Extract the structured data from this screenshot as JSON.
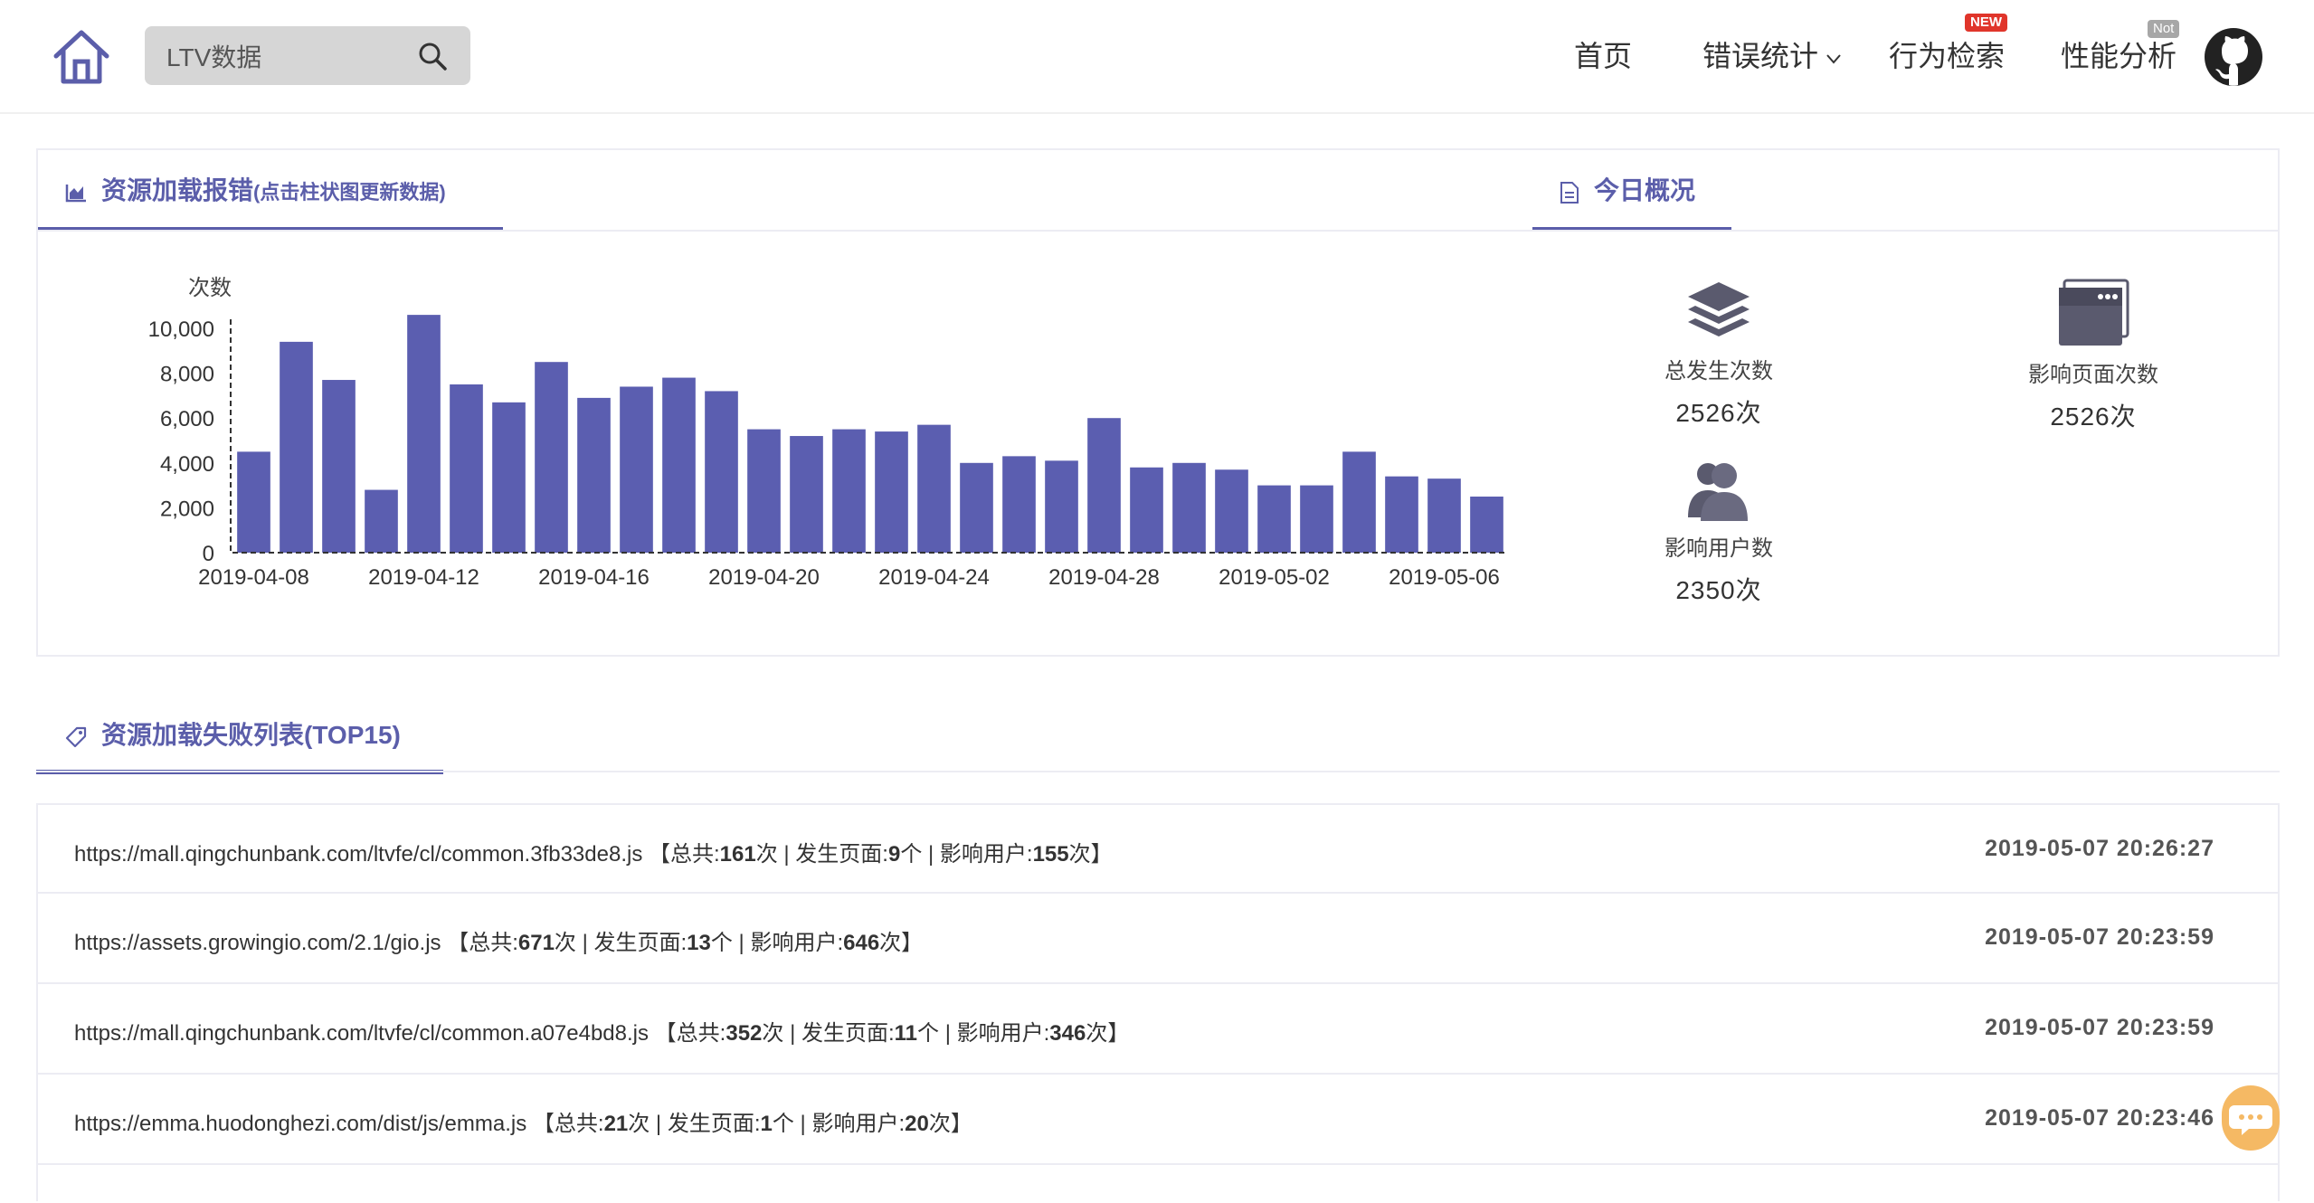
{
  "header": {
    "search": {
      "value": "LTV数据",
      "placeholder": ""
    },
    "nav": {
      "home": "首页",
      "errors": "错误统计",
      "behavior": "行为检索",
      "behavior_badge": "NEW",
      "performance": "性能分析",
      "performance_badge": "Not"
    },
    "icons": [
      "home-icon",
      "search-icon",
      "chevron-down-icon",
      "github-icon"
    ]
  },
  "resource_panel": {
    "tab_title": "资源加载报错",
    "tab_hint": "(点击柱状图更新数据)",
    "today_title": "今日概况"
  },
  "today": {
    "total_label": "总发生次数",
    "total_value": "2526次",
    "pages_label": "影响页面次数",
    "pages_value": "2526次",
    "users_label": "影响用户数",
    "users_value": "2350次"
  },
  "chart_data": {
    "type": "bar",
    "ylabel": "次数",
    "ylim": [
      0,
      11000
    ],
    "yticks": [
      0,
      2000,
      4000,
      6000,
      8000,
      10000
    ],
    "ytick_labels": [
      "0",
      "2,000",
      "4,000",
      "6,000",
      "8,000",
      "10,000"
    ],
    "xtick_labels": [
      "2019-04-08",
      "2019-04-12",
      "2019-04-16",
      "2019-04-20",
      "2019-04-24",
      "2019-04-28",
      "2019-05-02",
      "2019-05-06"
    ],
    "categories": [
      "2019-04-08",
      "2019-04-09",
      "2019-04-10",
      "2019-04-11",
      "2019-04-12",
      "2019-04-13",
      "2019-04-14",
      "2019-04-15",
      "2019-04-16",
      "2019-04-17",
      "2019-04-18",
      "2019-04-19",
      "2019-04-20",
      "2019-04-21",
      "2019-04-22",
      "2019-04-23",
      "2019-04-24",
      "2019-04-25",
      "2019-04-26",
      "2019-04-27",
      "2019-04-28",
      "2019-04-29",
      "2019-04-30",
      "2019-05-01",
      "2019-05-02",
      "2019-05-03",
      "2019-05-04",
      "2019-05-05",
      "2019-05-06",
      "2019-05-07"
    ],
    "values": [
      4500,
      9400,
      7700,
      2800,
      10600,
      7500,
      6700,
      8500,
      6900,
      7400,
      7800,
      7200,
      5500,
      5200,
      5500,
      5400,
      5700,
      4000,
      4300,
      4100,
      6000,
      3800,
      4000,
      3700,
      3000,
      3000,
      4500,
      3400,
      3300,
      2500
    ],
    "color": "#5b5eb0",
    "grid": false
  },
  "list": {
    "title": "资源加载失败列表(TOP15)",
    "items": [
      {
        "url": "https://mall.qingchunbank.com/ltvfe/cl/common.3fb33de8.js",
        "total": "161",
        "pages": "9",
        "users": "155",
        "time": "2019-05-07 20:26:27"
      },
      {
        "url": "https://assets.growingio.com/2.1/gio.js",
        "total": "671",
        "pages": "13",
        "users": "646",
        "time": "2019-05-07 20:23:59"
      },
      {
        "url": "https://mall.qingchunbank.com/ltvfe/cl/common.a07e4bd8.js",
        "total": "352",
        "pages": "11",
        "users": "346",
        "time": "2019-05-07 20:23:59"
      },
      {
        "url": "https://emma.huodonghezi.com/dist/js/emma.js",
        "total": "21",
        "pages": "1",
        "users": "20",
        "time": "2019-05-07 20:23:46"
      }
    ],
    "labels": {
      "open": " 【总共:",
      "count_unit": "次",
      "sep_pages": " | 发生页面:",
      "pages_unit": "个",
      "sep_users": " | 影响用户:",
      "close": "次】"
    }
  },
  "colors": {
    "accent": "#5b5eaa",
    "bar": "#5b5eb0",
    "new_badge": "#e0352b",
    "chat": "#f5b964"
  }
}
